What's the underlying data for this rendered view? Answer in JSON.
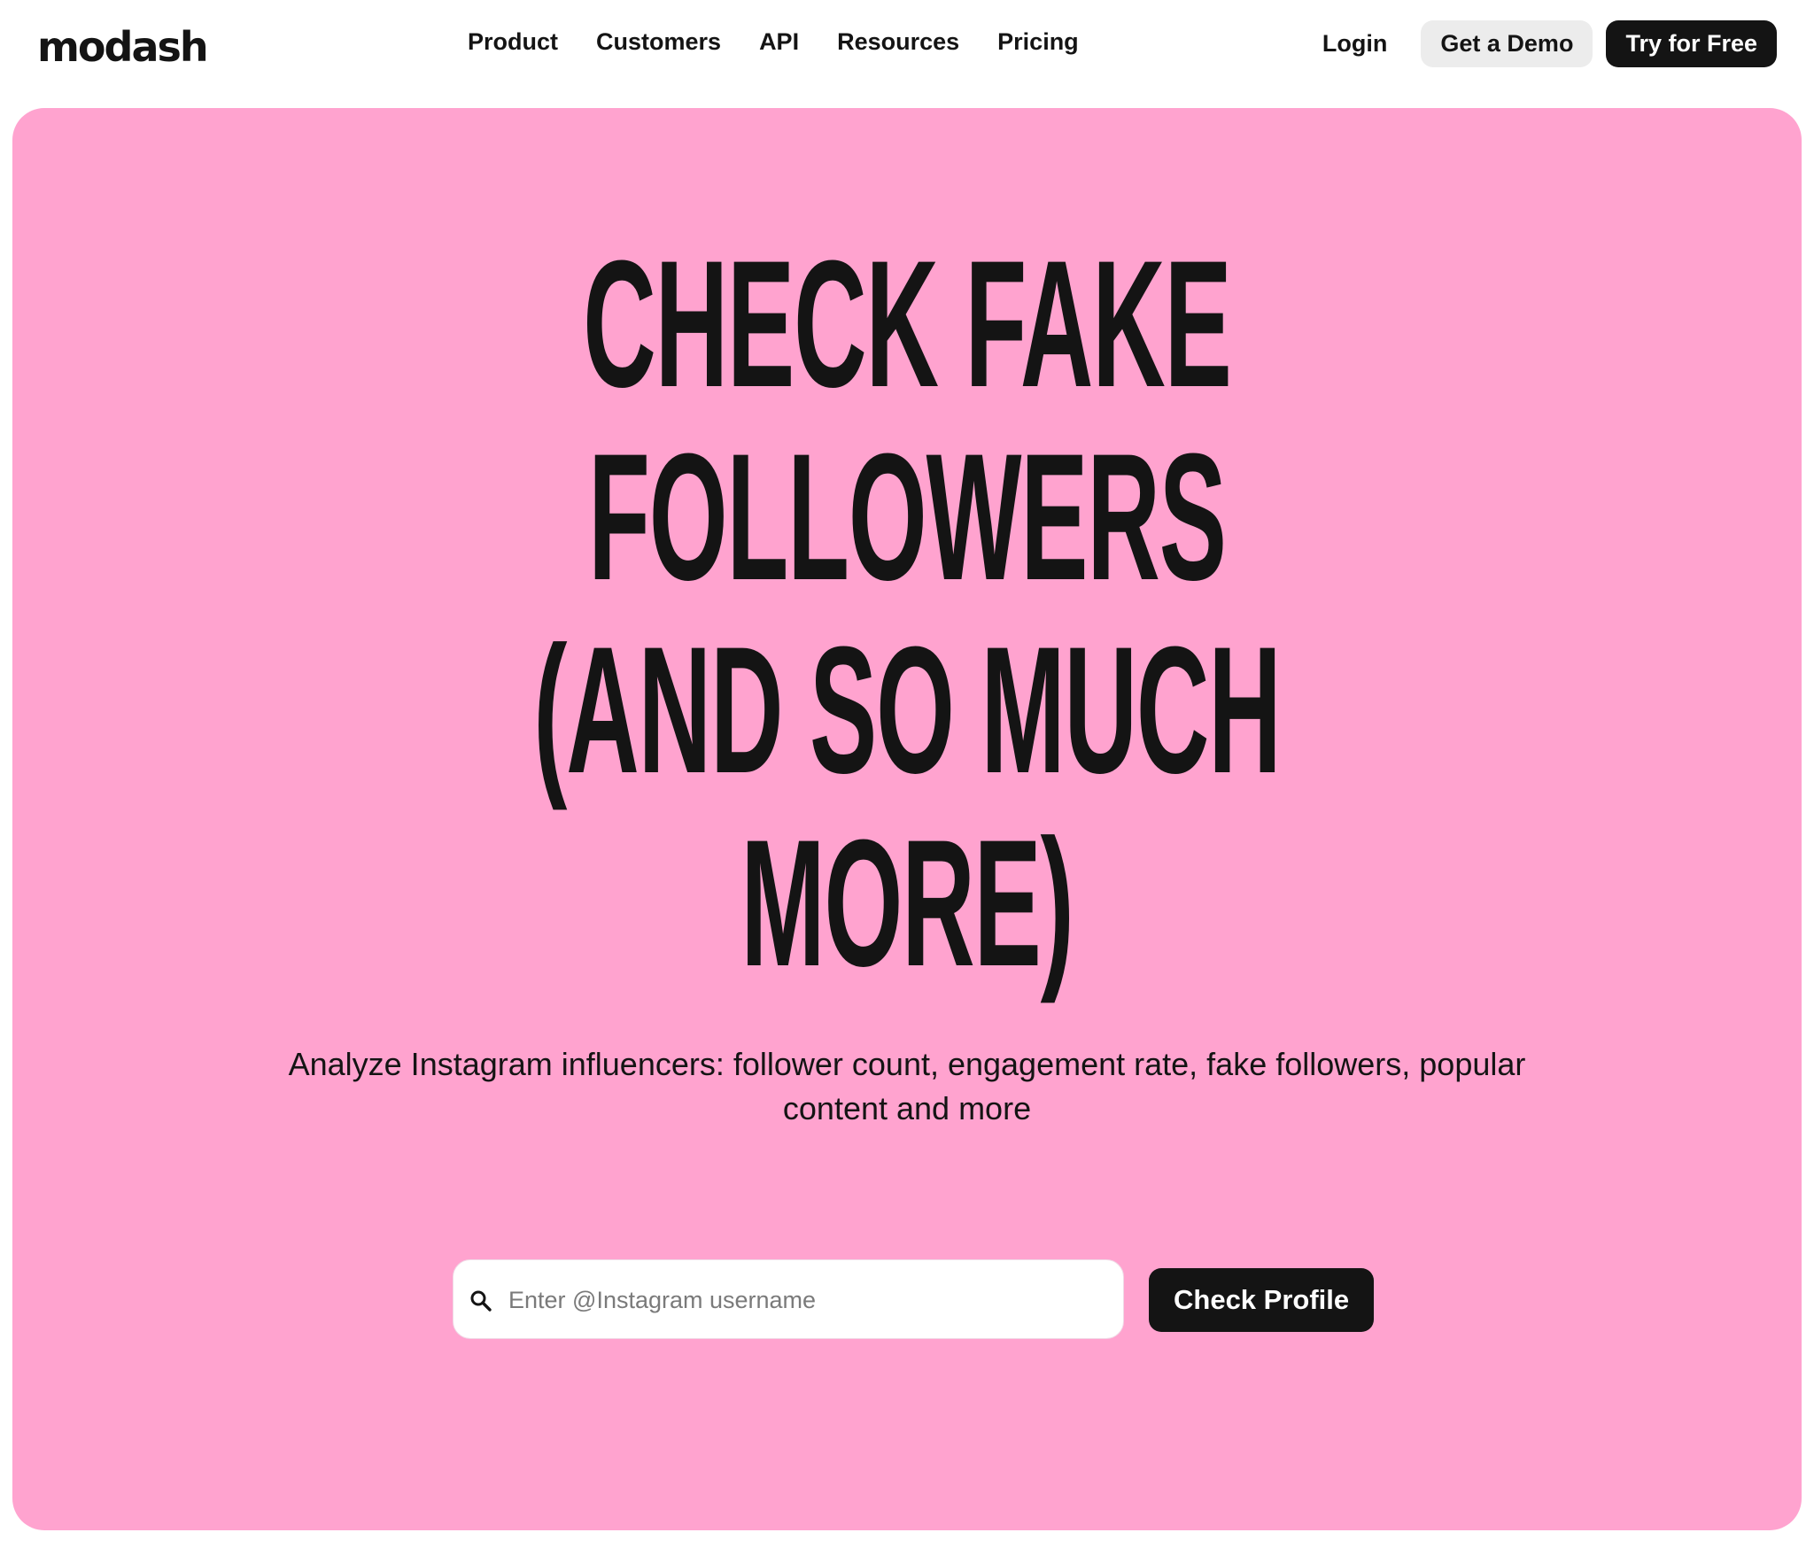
{
  "brand": {
    "logo_text": "modash"
  },
  "nav": {
    "links": [
      "Product",
      "Customers",
      "API",
      "Resources",
      "Pricing"
    ],
    "login_label": "Login",
    "demo_label": "Get a Demo",
    "free_label": "Try for Free"
  },
  "hero": {
    "headline_lines": [
      "CHECK FAKE",
      "FOLLOWERS",
      "(AND SO MUCH",
      "MORE)"
    ],
    "subtitle": "Analyze Instagram influencers: follower count, engagement rate, fake followers, popular content and more",
    "search": {
      "placeholder": "Enter @Instagram username",
      "value": ""
    },
    "check_button_label": "Check Profile"
  },
  "colors": {
    "hero_background": "#ffa3cf",
    "primary_dark": "#141414",
    "demo_button_bg": "#ececec"
  }
}
